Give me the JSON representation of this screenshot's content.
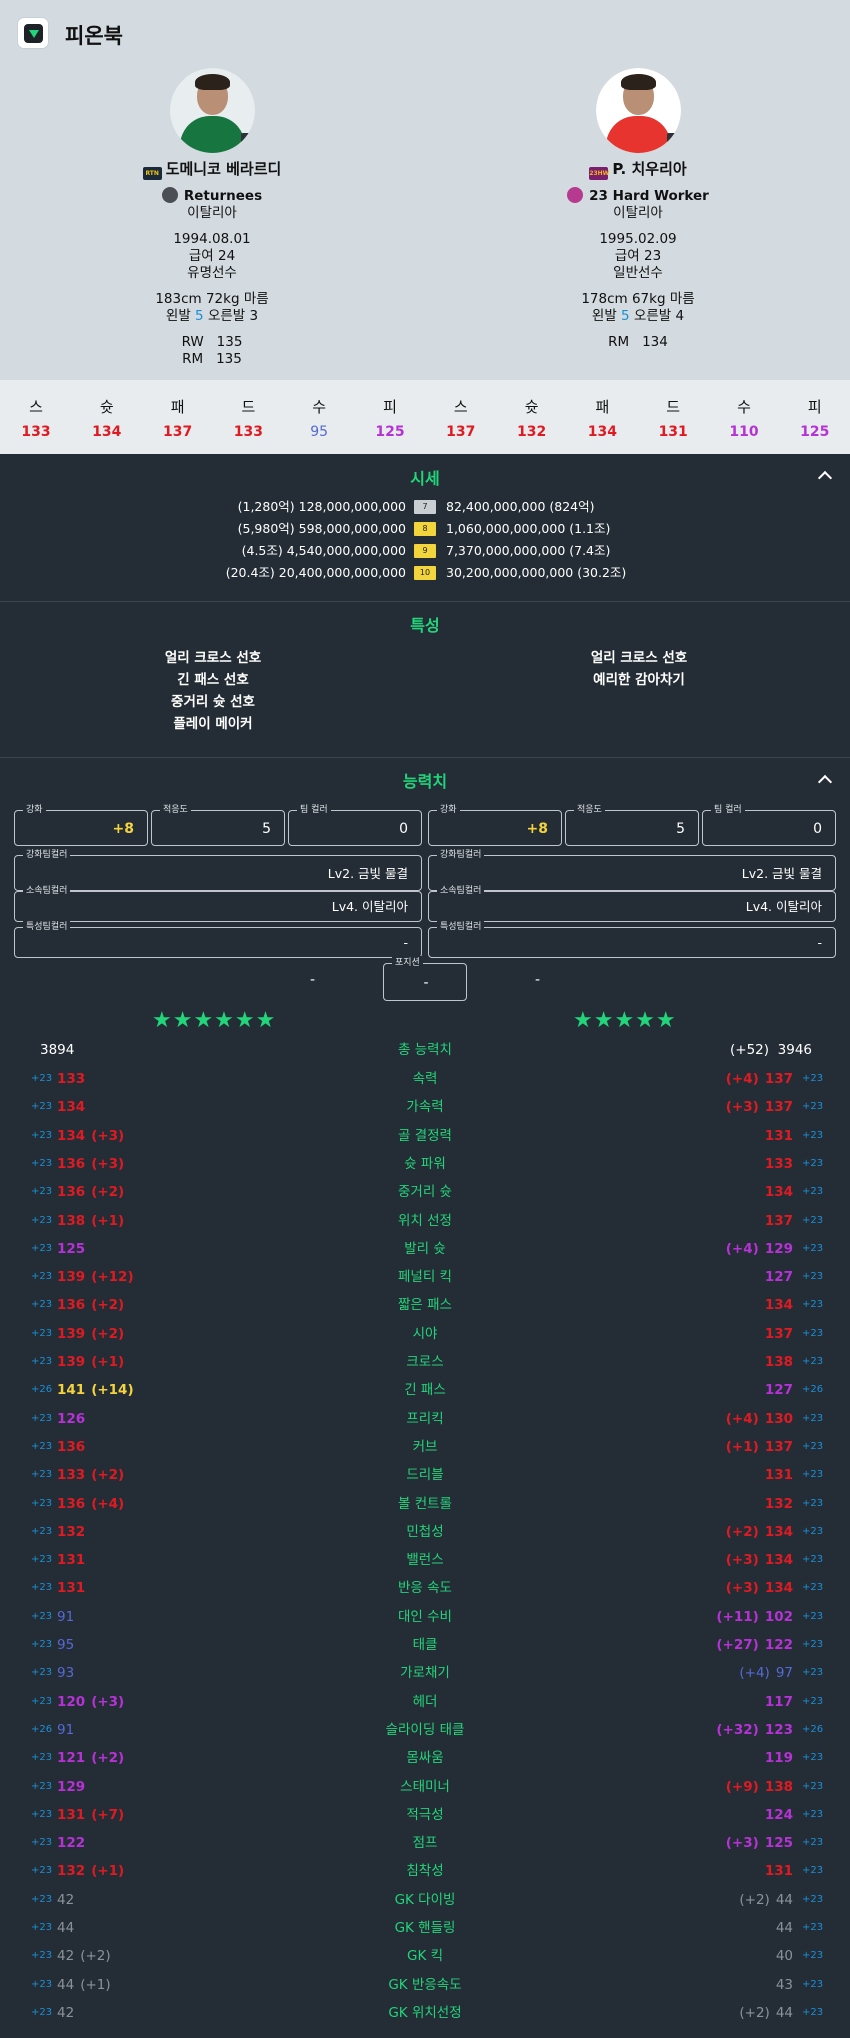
{
  "app": {
    "title": "피온북"
  },
  "colors": {
    "accent": "#22d47a",
    "red": "#e01a22",
    "purple": "#b632d6",
    "blue": "#5569d6",
    "yellow": "#f4d33d",
    "gray": "#8a9299"
  },
  "players": [
    {
      "season_badge": "RTN",
      "name": "도메니코 베라르디",
      "team": "Returnees",
      "nation": "이탈리아",
      "birth": "1994.08.01",
      "salary": "급여 24",
      "status": "유명선수",
      "body": "183cm 72kg 마름",
      "foot_left": "왼발",
      "foot_left_val": "5",
      "foot_right": "오른발 3",
      "positions": [
        {
          "pos": "RW",
          "ovr": "135"
        },
        {
          "pos": "RM",
          "ovr": "135"
        }
      ],
      "photo_colors": {
        "bg": "#e8eef0",
        "shirt": "#17753f"
      },
      "badge_colors": {
        "bg": "#1a2a3a",
        "fg": "#f0c419"
      },
      "team_color": "#4b4f55"
    },
    {
      "season_badge": "23HW",
      "name": "P. 치우리아",
      "team": "23 Hard Worker",
      "nation": "이탈리아",
      "birth": "1995.02.09",
      "salary": "급여 23",
      "status": "일반선수",
      "body": "178cm 67kg 마름",
      "foot_left": "왼발",
      "foot_left_val": "5",
      "foot_right": "오른발 4",
      "positions": [
        {
          "pos": "RM",
          "ovr": "134"
        }
      ],
      "photo_colors": {
        "bg": "#ffffff",
        "shirt": "#e8342e"
      },
      "badge_colors": {
        "bg": "#7a1f6e",
        "fg": "#f2b41c"
      },
      "team_color": "#b63a8f"
    }
  ],
  "summary_tabs": {
    "labels": [
      "스",
      "슛",
      "패",
      "드",
      "수",
      "피",
      "스",
      "슛",
      "패",
      "드",
      "수",
      "피"
    ],
    "values": [
      "133",
      "134",
      "137",
      "133",
      "95",
      "125",
      "137",
      "132",
      "134",
      "131",
      "110",
      "125"
    ],
    "value_colors": [
      "red",
      "red",
      "red",
      "red",
      "blue",
      "purple",
      "red",
      "red",
      "red",
      "red",
      "purple",
      "purple"
    ]
  },
  "price_section": {
    "title": "시세",
    "rows": [
      {
        "left": "(1,280억) 128,000,000,000",
        "badge": "7",
        "right": "82,400,000,000 (824억)",
        "badge_color": "#c9ced2"
      },
      {
        "left": "(5,980억) 598,000,000,000",
        "badge": "8",
        "right": "1,060,000,000,000 (1.1조)",
        "badge_color": "#f2d53c"
      },
      {
        "left": "(4.5조) 4,540,000,000,000",
        "badge": "9",
        "right": "7,370,000,000,000 (7.4조)",
        "badge_color": "#f2d53c"
      },
      {
        "left": "(20.4조) 20,400,000,000,000",
        "badge": "10",
        "right": "30,200,000,000,000 (30.2조)",
        "badge_color": "#f2d53c"
      }
    ]
  },
  "traits_section": {
    "title": "특성",
    "left": [
      "얼리 크로스 선호",
      "긴 패스 선호",
      "중거리 슛 선호",
      "플레이 메이커"
    ],
    "right": [
      "얼리 크로스 선호",
      "예리한 감아차기"
    ]
  },
  "ability_section": {
    "title": "능력치",
    "fields": {
      "enhance_label": "강화",
      "enhance_value": "+8",
      "adapt_label": "적응도",
      "adapt_value": "5",
      "teamcolor_label": "팀 컬러",
      "teamcolor_value": "0",
      "enh_team_label": "강화팀컬러",
      "enh_team_value": "Lv2. 금빛 물결",
      "club_team_label": "소속팀컬러",
      "club_team_value": "Lv4. 이탈리아",
      "trait_team_label": "특성팀컬러",
      "trait_team_value": "-"
    },
    "position_label": "포지션",
    "position_value": "-",
    "left_dash": "-",
    "right_dash": "-",
    "left_stars": "★★★★★★",
    "right_stars": "★★★★★"
  },
  "totals": {
    "left": "3894",
    "label": "총 능력치",
    "right_delta": "(+52)",
    "right": "3946"
  },
  "stats": [
    {
      "name": "속력",
      "lb": "+23",
      "lv": "133",
      "ld": "",
      "lc": "red",
      "rv": "137",
      "rd": "(+4)",
      "rc": "red",
      "rb": "+23"
    },
    {
      "name": "가속력",
      "lb": "+23",
      "lv": "134",
      "ld": "",
      "lc": "red",
      "rv": "137",
      "rd": "(+3)",
      "rc": "red",
      "rb": "+23"
    },
    {
      "name": "골 결정력",
      "lb": "+23",
      "lv": "134",
      "ld": "(+3)",
      "lc": "red",
      "rv": "131",
      "rd": "",
      "rc": "red",
      "rb": "+23"
    },
    {
      "name": "슛 파워",
      "lb": "+23",
      "lv": "136",
      "ld": "(+3)",
      "lc": "red",
      "rv": "133",
      "rd": "",
      "rc": "red",
      "rb": "+23"
    },
    {
      "name": "중거리 슛",
      "lb": "+23",
      "lv": "136",
      "ld": "(+2)",
      "lc": "red",
      "rv": "134",
      "rd": "",
      "rc": "red",
      "rb": "+23"
    },
    {
      "name": "위치 선정",
      "lb": "+23",
      "lv": "138",
      "ld": "(+1)",
      "lc": "red",
      "rv": "137",
      "rd": "",
      "rc": "red",
      "rb": "+23"
    },
    {
      "name": "발리 슛",
      "lb": "+23",
      "lv": "125",
      "ld": "",
      "lc": "purple",
      "rv": "129",
      "rd": "(+4)",
      "rc": "purple",
      "rb": "+23"
    },
    {
      "name": "페널티 킥",
      "lb": "+23",
      "lv": "139",
      "ld": "(+12)",
      "lc": "red",
      "rv": "127",
      "rd": "",
      "rc": "purple",
      "rb": "+23"
    },
    {
      "name": "짧은 패스",
      "lb": "+23",
      "lv": "136",
      "ld": "(+2)",
      "lc": "red",
      "rv": "134",
      "rd": "",
      "rc": "red",
      "rb": "+23"
    },
    {
      "name": "시야",
      "lb": "+23",
      "lv": "139",
      "ld": "(+2)",
      "lc": "red",
      "rv": "137",
      "rd": "",
      "rc": "red",
      "rb": "+23"
    },
    {
      "name": "크로스",
      "lb": "+23",
      "lv": "139",
      "ld": "(+1)",
      "lc": "red",
      "rv": "138",
      "rd": "",
      "rc": "red",
      "rb": "+23"
    },
    {
      "name": "긴 패스",
      "lb": "+26",
      "lv": "141",
      "ld": "(+14)",
      "lc": "yellow",
      "rv": "127",
      "rd": "",
      "rc": "purple",
      "rb": "+26"
    },
    {
      "name": "프리킥",
      "lb": "+23",
      "lv": "126",
      "ld": "",
      "lc": "purple",
      "rv": "130",
      "rd": "(+4)",
      "rc": "red",
      "rb": "+23"
    },
    {
      "name": "커브",
      "lb": "+23",
      "lv": "136",
      "ld": "",
      "lc": "red",
      "rv": "137",
      "rd": "(+1)",
      "rc": "red",
      "rb": "+23"
    },
    {
      "name": "드리블",
      "lb": "+23",
      "lv": "133",
      "ld": "(+2)",
      "lc": "red",
      "rv": "131",
      "rd": "",
      "rc": "red",
      "rb": "+23"
    },
    {
      "name": "볼 컨트롤",
      "lb": "+23",
      "lv": "136",
      "ld": "(+4)",
      "lc": "red",
      "rv": "132",
      "rd": "",
      "rc": "red",
      "rb": "+23"
    },
    {
      "name": "민첩성",
      "lb": "+23",
      "lv": "132",
      "ld": "",
      "lc": "red",
      "rv": "134",
      "rd": "(+2)",
      "rc": "red",
      "rb": "+23"
    },
    {
      "name": "밸런스",
      "lb": "+23",
      "lv": "131",
      "ld": "",
      "lc": "red",
      "rv": "134",
      "rd": "(+3)",
      "rc": "red",
      "rb": "+23"
    },
    {
      "name": "반응 속도",
      "lb": "+23",
      "lv": "131",
      "ld": "",
      "lc": "red",
      "rv": "134",
      "rd": "(+3)",
      "rc": "red",
      "rb": "+23"
    },
    {
      "name": "대인 수비",
      "lb": "+23",
      "lv": "91",
      "ld": "",
      "lc": "blue",
      "rv": "102",
      "rd": "(+11)",
      "rc": "purple",
      "rb": "+23"
    },
    {
      "name": "태클",
      "lb": "+23",
      "lv": "95",
      "ld": "",
      "lc": "blue",
      "rv": "122",
      "rd": "(+27)",
      "rc": "purple",
      "rb": "+23"
    },
    {
      "name": "가로채기",
      "lb": "+23",
      "lv": "93",
      "ld": "",
      "lc": "blue",
      "rv": "97",
      "rd": "(+4)",
      "rc": "blue",
      "rb": "+23"
    },
    {
      "name": "헤더",
      "lb": "+23",
      "lv": "120",
      "ld": "(+3)",
      "lc": "purple",
      "rv": "117",
      "rd": "",
      "rc": "purple",
      "rb": "+23"
    },
    {
      "name": "슬라이딩 태클",
      "lb": "+26",
      "lv": "91",
      "ld": "",
      "lc": "blue",
      "rv": "123",
      "rd": "(+32)",
      "rc": "purple",
      "rb": "+26"
    },
    {
      "name": "몸싸움",
      "lb": "+23",
      "lv": "121",
      "ld": "(+2)",
      "lc": "purple",
      "rv": "119",
      "rd": "",
      "rc": "purple",
      "rb": "+23"
    },
    {
      "name": "스태미너",
      "lb": "+23",
      "lv": "129",
      "ld": "",
      "lc": "purple",
      "rv": "138",
      "rd": "(+9)",
      "rc": "red",
      "rb": "+23"
    },
    {
      "name": "적극성",
      "lb": "+23",
      "lv": "131",
      "ld": "(+7)",
      "lc": "red",
      "rv": "124",
      "rd": "",
      "rc": "purple",
      "rb": "+23"
    },
    {
      "name": "점프",
      "lb": "+23",
      "lv": "122",
      "ld": "",
      "lc": "purple",
      "rv": "125",
      "rd": "(+3)",
      "rc": "purple",
      "rb": "+23"
    },
    {
      "name": "침착성",
      "lb": "+23",
      "lv": "132",
      "ld": "(+1)",
      "lc": "red",
      "rv": "131",
      "rd": "",
      "rc": "red",
      "rb": "+23"
    },
    {
      "name": "GK 다이빙",
      "lb": "+23",
      "lv": "42",
      "ld": "",
      "lc": "gray",
      "rv": "44",
      "rd": "(+2)",
      "rc": "gray",
      "rb": "+23"
    },
    {
      "name": "GK 핸들링",
      "lb": "+23",
      "lv": "44",
      "ld": "",
      "lc": "gray",
      "rv": "44",
      "rd": "",
      "rc": "gray",
      "rb": "+23"
    },
    {
      "name": "GK 킥",
      "lb": "+23",
      "lv": "42",
      "ld": "(+2)",
      "lc": "gray",
      "rv": "40",
      "rd": "",
      "rc": "gray",
      "rb": "+23"
    },
    {
      "name": "GK 반응속도",
      "lb": "+23",
      "lv": "44",
      "ld": "(+1)",
      "lc": "gray",
      "rv": "43",
      "rd": "",
      "rc": "gray",
      "rb": "+23"
    },
    {
      "name": "GK 위치선정",
      "lb": "+23",
      "lv": "42",
      "ld": "",
      "lc": "gray",
      "rv": "44",
      "rd": "(+2)",
      "rc": "gray",
      "rb": "+23"
    }
  ]
}
